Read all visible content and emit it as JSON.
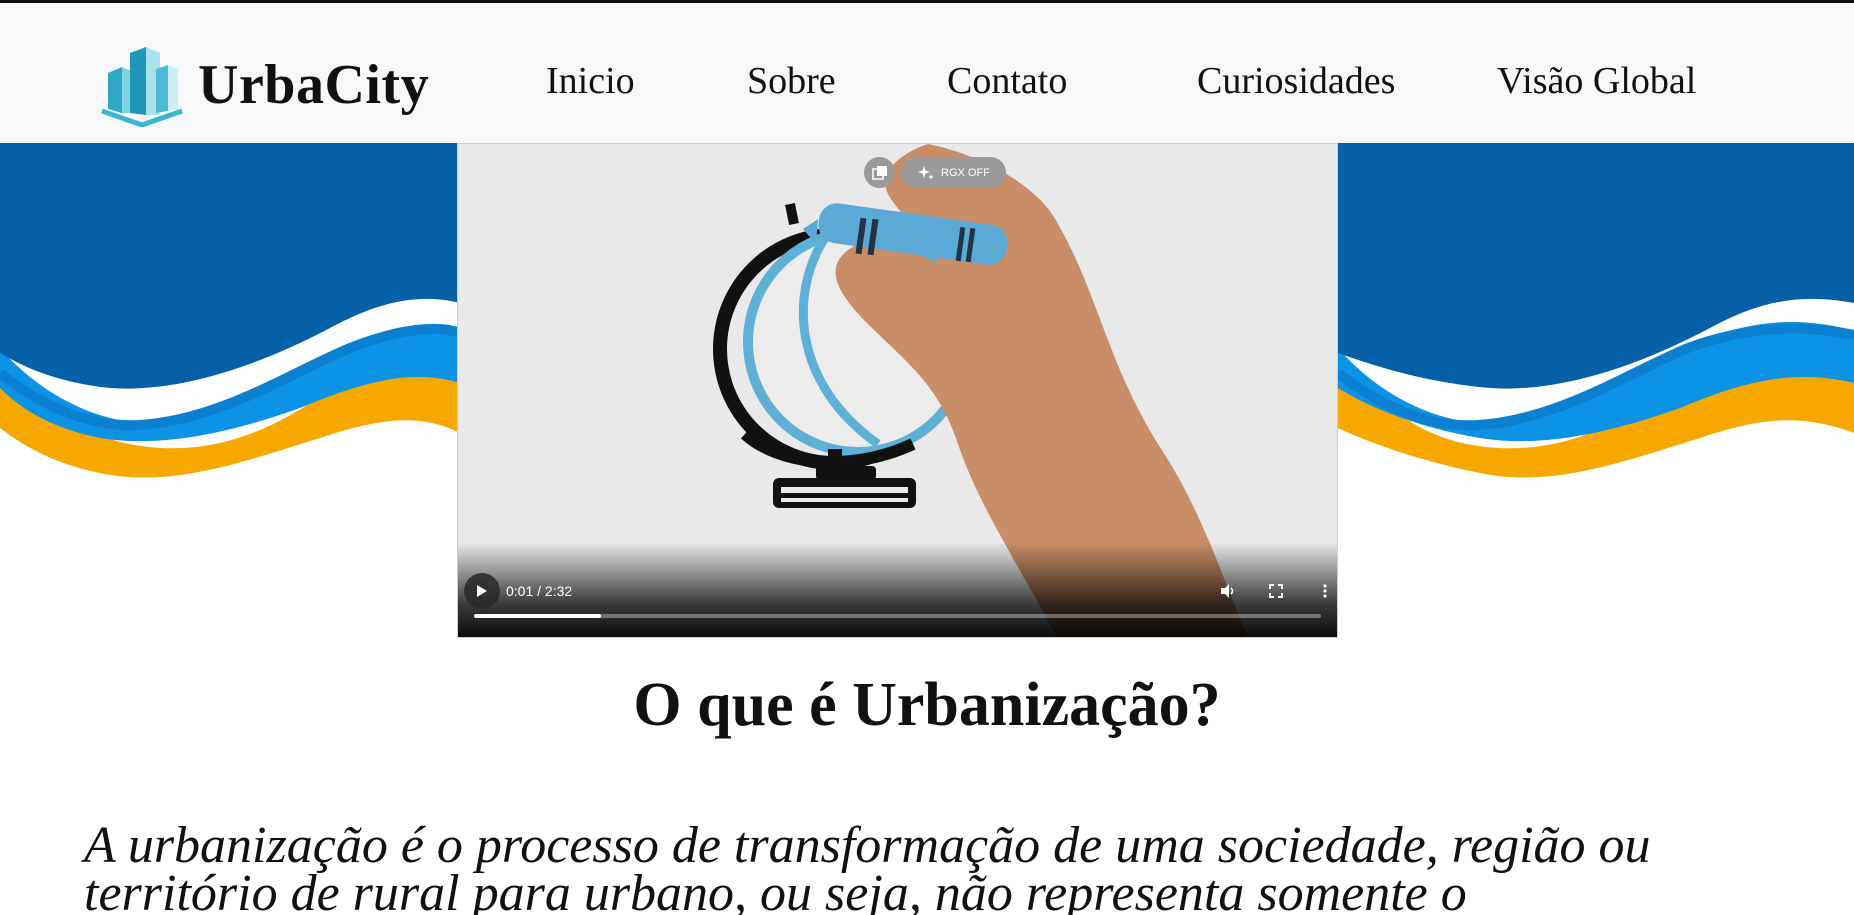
{
  "header": {
    "brand": "UrbaCity",
    "nav": [
      {
        "label": "Inicio"
      },
      {
        "label": "Sobre"
      },
      {
        "label": "Contato"
      },
      {
        "label": "Curiosidades"
      },
      {
        "label": "Visão Global"
      }
    ]
  },
  "video": {
    "overlay_label": "RGX OFF",
    "time": "0:01 / 2:32",
    "progress": 0.0066
  },
  "content": {
    "title": "O que é Urbanização?",
    "paragraph": "A urbanização é o processo de transformação de uma sociedade, região ou território de rural para urbano, ou seja, não representa somente o"
  },
  "colors": {
    "header_bg": "#f7f8fa",
    "wave_dark_blue": "#0560a8",
    "wave_light_blue": "#0d93e6",
    "wave_orange": "#f7a800",
    "logo_teal": "#5bc4d8"
  },
  "icons": [
    "buildings-logo-icon",
    "pip-icon",
    "sparkle-icon",
    "play-icon",
    "volume-icon",
    "fullscreen-icon",
    "more-vert-icon"
  ]
}
